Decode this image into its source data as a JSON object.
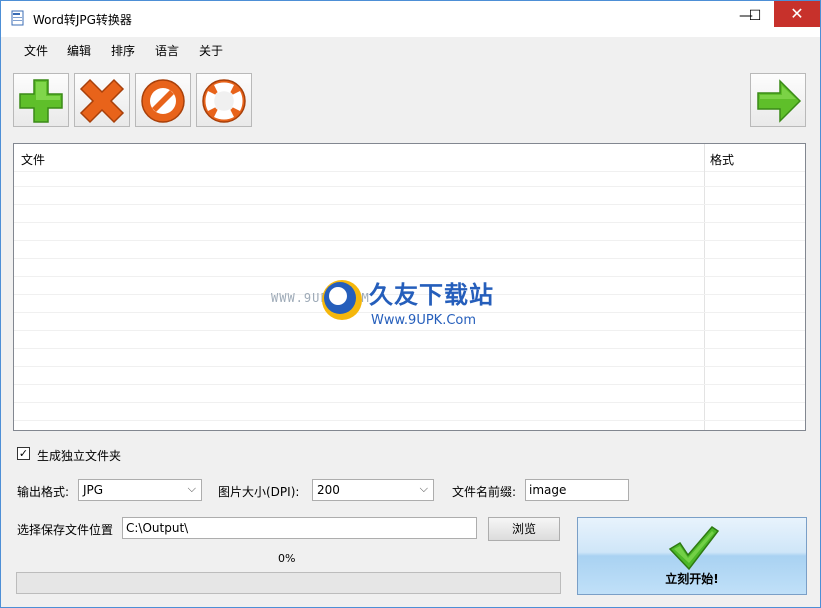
{
  "window": {
    "title": "Word转JPG转换器",
    "controls": {
      "minimize": "—",
      "maximize": "☐",
      "close": "✕"
    }
  },
  "menu": [
    "文件",
    "编辑",
    "排序",
    "语言",
    "关于"
  ],
  "toolbar": {
    "icons": [
      "add-icon",
      "remove-icon",
      "clear-icon",
      "help-icon",
      "next-arrow-icon"
    ]
  },
  "file_list": {
    "columns": [
      "文件",
      "格式"
    ],
    "rows": []
  },
  "watermark": {
    "url": "WWW.9UPK.COM",
    "title": "久友下载站",
    "site": "Www.9UPK.Com"
  },
  "options": {
    "separate_folder_label": "生成独立文件夹",
    "separate_folder_checked": true,
    "output_format_label": "输出格式:",
    "output_format_value": "JPG",
    "image_size_label": "图片大小(DPI):",
    "image_size_value": "200",
    "prefix_label": "文件名前缀:",
    "prefix_value": "image",
    "save_location_label": "选择保存文件位置",
    "save_location_value": "C:\\Output\\",
    "browse_label": "浏览"
  },
  "progress": {
    "percent_text": "0%",
    "value": 0
  },
  "start": {
    "label": "立刻开始!"
  },
  "colors": {
    "window_border": "#4d8fd6",
    "close_red": "#c7312b",
    "add_green": "#5fbf2a",
    "remove_orange": "#e8631a",
    "start_blue": "#a9d2f2"
  }
}
